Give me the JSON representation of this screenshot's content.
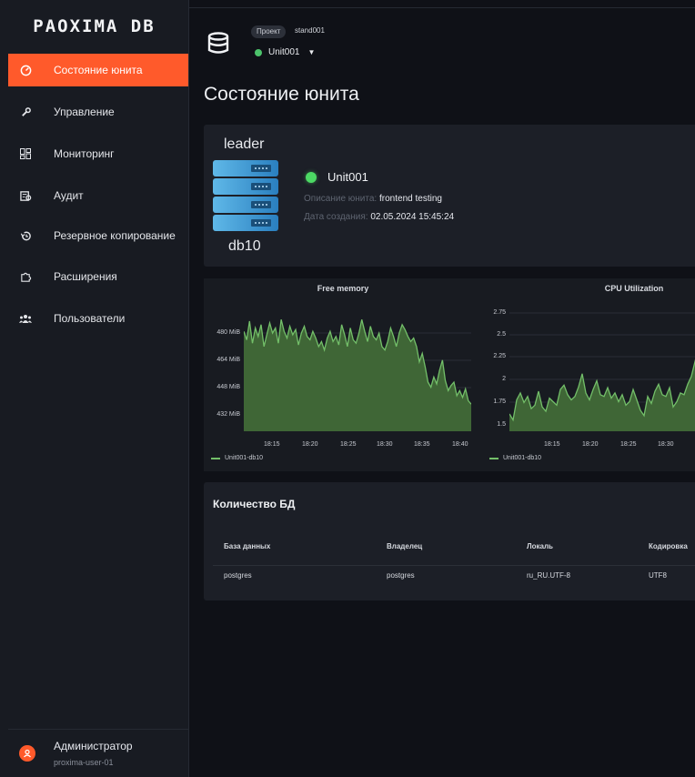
{
  "sidebar": {
    "logo": "PAOXIMA DB",
    "items": [
      {
        "label": "Состояние юнита",
        "icon": "speedometer-icon"
      },
      {
        "label": "Управление",
        "icon": "wrench-icon"
      },
      {
        "label": "Мониторинг",
        "icon": "dashboard-icon"
      },
      {
        "label": "Аудит",
        "icon": "audit-icon"
      },
      {
        "label": "Резервное копирование",
        "icon": "backup-icon"
      },
      {
        "label": "Расширения",
        "icon": "puzzle-icon"
      },
      {
        "label": "Пользователи",
        "icon": "users-icon"
      }
    ],
    "active_index": 0,
    "user": {
      "name": "Администратор",
      "login": "proxima-user-01"
    }
  },
  "header": {
    "project_badge": "Проект",
    "project_name": "stand001",
    "unit_selector": "Unit001"
  },
  "page": {
    "title": "Состояние юнита"
  },
  "unit_card": {
    "role": "leader",
    "host": "db10",
    "unit_name": "Unit001",
    "status_color": "#4cd964",
    "description_label": "Описание юнита:",
    "description_value": "frontend testing",
    "created_label": "Дата создания:",
    "created_value": "02.05.2024 15:45:24"
  },
  "chart_data": [
    {
      "type": "area",
      "title": "Free memory",
      "y_ticks": [
        "480 MiB",
        "464 MiB",
        "448 MiB",
        "432 MiB"
      ],
      "x_ticks": [
        "18:15",
        "18:20",
        "18:25",
        "18:30",
        "18:35",
        "18:40"
      ],
      "ylim": [
        420,
        492
      ],
      "series": [
        {
          "name": "Unit001-db10",
          "color": "#73bf69",
          "values": [
            479,
            474,
            485,
            472,
            481,
            476,
            483,
            470,
            477,
            484,
            478,
            481,
            472,
            486,
            479,
            475,
            482,
            477,
            480,
            471,
            478,
            482,
            476,
            474,
            479,
            475,
            470,
            473,
            468,
            475,
            479,
            473,
            476,
            471,
            483,
            477,
            470,
            481,
            474,
            472,
            478,
            486,
            479,
            473,
            482,
            476,
            474,
            478,
            470,
            468,
            473,
            481,
            476,
            470,
            478,
            483,
            480,
            476,
            473,
            475,
            470,
            461,
            466,
            458,
            449,
            446,
            452,
            448,
            456,
            462,
            450,
            444,
            447,
            449,
            441,
            444,
            440,
            445,
            438,
            436
          ]
        }
      ]
    },
    {
      "type": "area",
      "title": "CPU Utilization",
      "y_ticks": [
        "2.75",
        "2.5",
        "2.25",
        "2",
        "1.75",
        "1.5"
      ],
      "x_ticks": [
        "18:15",
        "18:20",
        "18:25",
        "18:30"
      ],
      "ylim": [
        1.42,
        2.82
      ],
      "series": [
        {
          "name": "Unit001-db10",
          "color": "#73bf69",
          "values": [
            1.62,
            1.55,
            1.78,
            1.86,
            1.75,
            1.82,
            1.68,
            1.72,
            1.88,
            1.7,
            1.65,
            1.8,
            1.76,
            1.72,
            1.9,
            1.95,
            1.84,
            1.78,
            1.82,
            1.93,
            2.08,
            1.86,
            1.78,
            1.9,
            2.0,
            1.84,
            1.82,
            1.92,
            1.8,
            1.86,
            1.76,
            1.84,
            1.72,
            1.76,
            1.9,
            1.78,
            1.66,
            1.6,
            1.82,
            1.74,
            1.88,
            1.96,
            1.84,
            1.82,
            1.92,
            1.7,
            1.76,
            1.86,
            1.84,
            1.96,
            2.05,
            2.22,
            2.38,
            2.3
          ]
        }
      ]
    }
  ],
  "db_table": {
    "title": "Количество БД",
    "columns": [
      "База данных",
      "Владелец",
      "Локаль",
      "Кодировка"
    ],
    "rows": [
      [
        "postgres",
        "postgres",
        "ru_RU.UTF-8",
        "UTF8"
      ]
    ]
  }
}
